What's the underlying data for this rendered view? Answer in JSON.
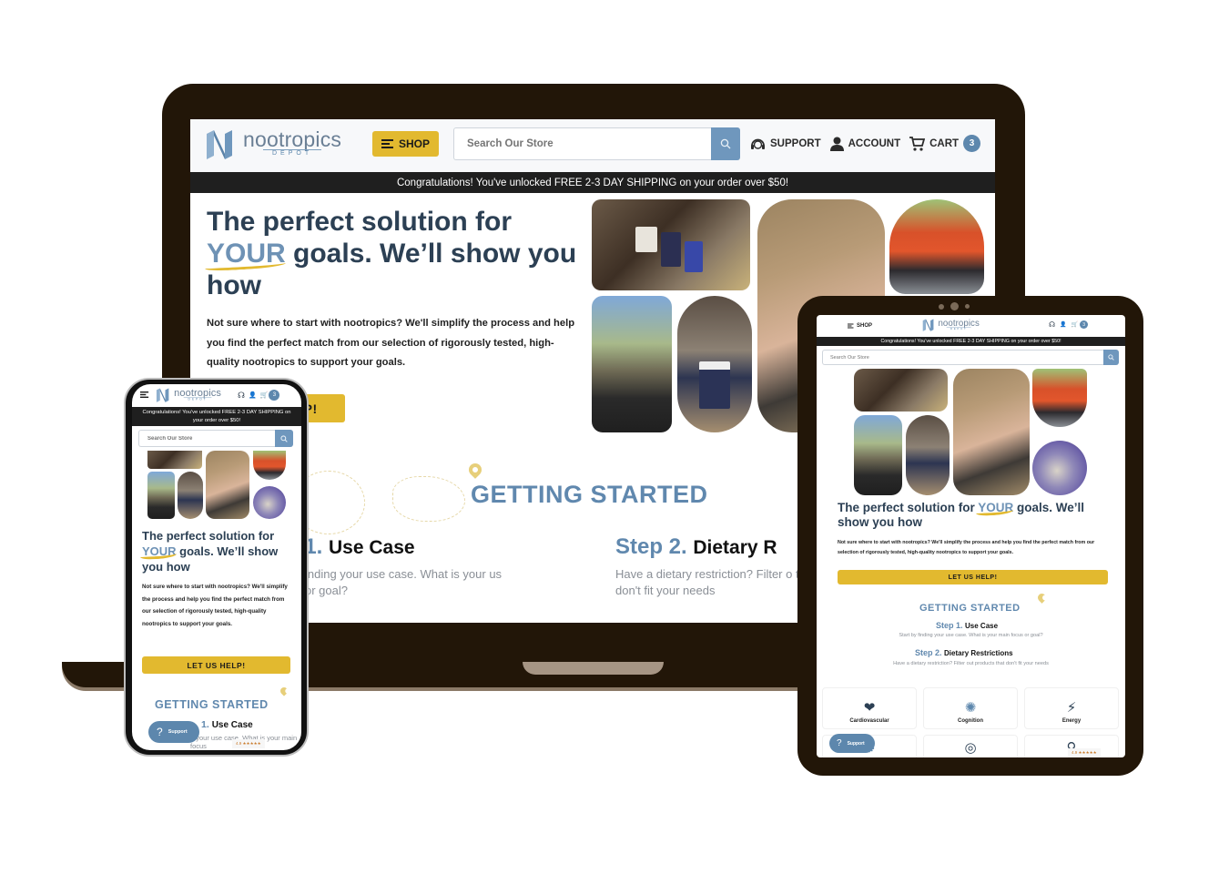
{
  "brand": {
    "name": "nootropics",
    "sub": "DEPOT",
    "colors": {
      "navy": "#2c4054",
      "steel_blue": "#5d87ad",
      "gold": "#e2b92f",
      "device_frame": "#221608"
    }
  },
  "header": {
    "shop_label": "SHOP",
    "search_placeholder": "Search Our Store",
    "support_label": "SUPPORT",
    "account_label": "ACCOUNT",
    "cart_label": "CART",
    "cart_count": "3"
  },
  "icons": {
    "menu": "menu-icon",
    "search": "search-icon",
    "support": "headset-icon",
    "account": "user-icon",
    "cart": "cart-icon"
  },
  "shipping_banner": "Congratulations! You've unlocked FREE 2-3 DAY SHIPPING on your order over $50!",
  "hero": {
    "title_pre": "The perfect solution for ",
    "title_highlight": "YOUR",
    "title_post": " goals. We’ll show you how",
    "body": "Not sure where to start with nootropics? We'll simplify the process and help you find the perfect match from our selection of rigorously tested, high-quality nootropics to support your goals.",
    "cta_label": "LET US HELP!",
    "cta_partial_label": ".P!"
  },
  "getting_started": {
    "title": "GETTING STARTED",
    "steps": [
      {
        "number": "Step 1.",
        "name": "Use Case",
        "description": "Start by finding your use case. What is your main focus or goal?"
      },
      {
        "number": "Step 2.",
        "name": "Dietary Restrictions",
        "description": "Have a dietary restriction? Filter out products that don't fit your needs"
      }
    ],
    "laptop_visible": {
      "step1_number": "p 1.",
      "step1_name": "Use Case",
      "step1_desc": "inding your use case. What is your us or goal?",
      "step2_number": "Step 2.",
      "step2_name": "Dietary R",
      "step2_desc": "Have a dietary restriction? Filter o that don't fit your needs"
    },
    "phone_visible": {
      "step1_number": "1.",
      "step1_name": "Use Case",
      "step1_desc": "g your use case. What is your main focus"
    }
  },
  "categories": [
    {
      "label": "Cardiovascular",
      "icon": "heart-icon",
      "glyph": "❤"
    },
    {
      "label": "Cognition",
      "icon": "brain-icon",
      "glyph": "✺"
    },
    {
      "label": "Energy",
      "icon": "lightning-icon",
      "glyph": "⚡"
    },
    {
      "label": "",
      "icon": "gear-icon",
      "glyph": "⚙"
    },
    {
      "label": "",
      "icon": "target-icon",
      "glyph": "◎"
    },
    {
      "label": "",
      "icon": "figure-icon",
      "glyph": "⚲"
    }
  ],
  "support_widget": {
    "label": "Support",
    "glyph": "?"
  },
  "rating_widget": {
    "text": "4.9 ★★★★★"
  },
  "glyphs": {
    "headset": "☊",
    "user": "👤",
    "cart": "🛒",
    "search": "⌕"
  }
}
